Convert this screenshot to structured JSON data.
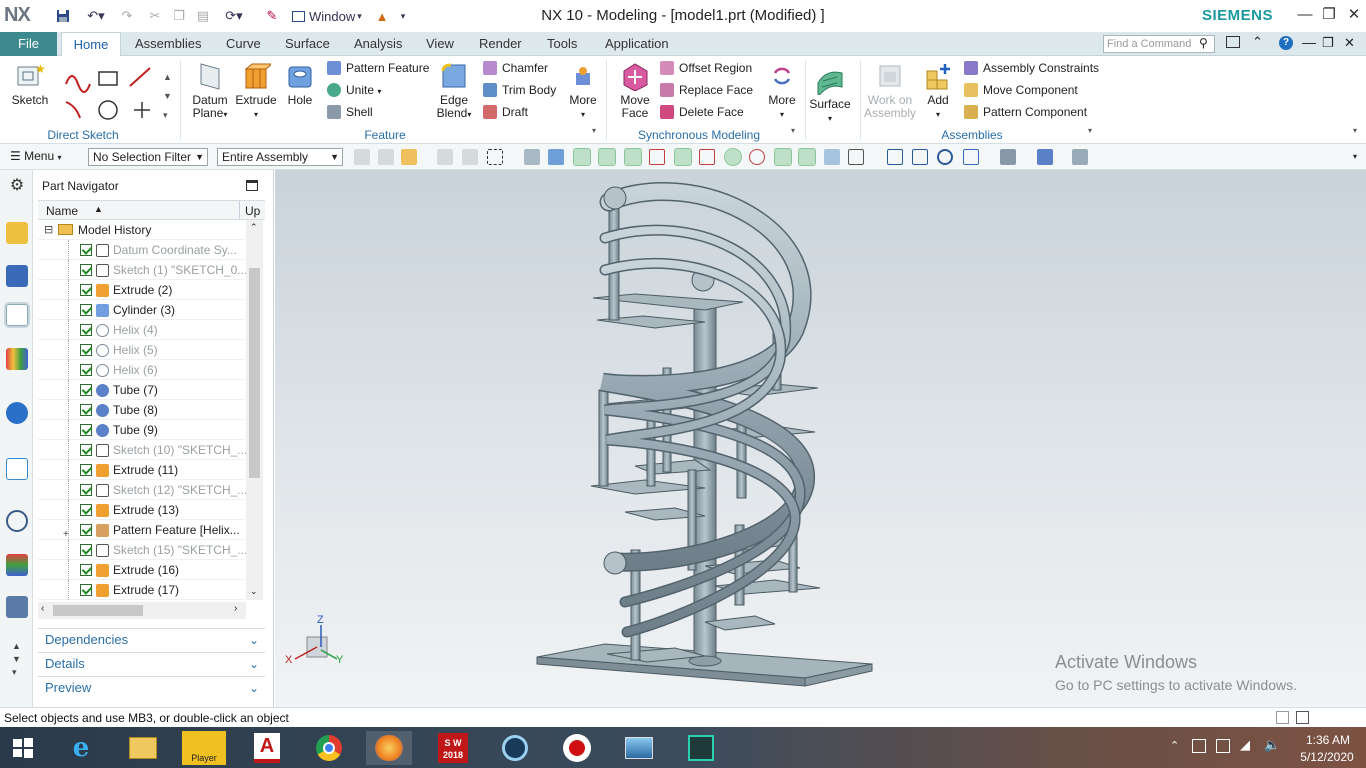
{
  "titlebar": {
    "logo": "NX",
    "window_menu": "Window",
    "title": "NX 10 - Modeling - [model1.prt (Modified) ]",
    "brand": "SIEMENS",
    "brand_color": "#1a9aa0"
  },
  "ribbon_tabs": {
    "file": "File",
    "tabs": [
      "Home",
      "Assemblies",
      "Curve",
      "Surface",
      "Analysis",
      "View",
      "Render",
      "Tools",
      "Application"
    ],
    "active": "Home",
    "find_placeholder": "Find a Command"
  },
  "ribbon": {
    "direct_sketch": {
      "sketch": "Sketch",
      "group": "Direct Sketch"
    },
    "feature": {
      "datum_plane_1": "Datum",
      "datum_plane_2": "Plane",
      "extrude": "Extrude",
      "hole": "Hole",
      "pattern_feature": "Pattern Feature",
      "unite": "Unite",
      "shell": "Shell",
      "edge_blend_1": "Edge",
      "edge_blend_2": "Blend",
      "chamfer": "Chamfer",
      "trim_body": "Trim Body",
      "draft": "Draft",
      "more": "More",
      "group": "Feature"
    },
    "sync": {
      "move_face_1": "Move",
      "move_face_2": "Face",
      "offset_region": "Offset Region",
      "replace_face": "Replace Face",
      "delete_face": "Delete Face",
      "more": "More",
      "group": "Synchronous Modeling"
    },
    "surface": {
      "label": "Surface"
    },
    "assemblies": {
      "work_on_1": "Work on",
      "work_on_2": "Assembly",
      "add": "Add",
      "constraints": "Assembly Constraints",
      "move_component": "Move Component",
      "pattern_component": "Pattern Component",
      "group": "Assemblies"
    }
  },
  "toolbar": {
    "menu": "Menu",
    "selection_filter": "No Selection Filter",
    "scope": "Entire Assembly"
  },
  "navigator": {
    "title": "Part Navigator",
    "col_name": "Name",
    "col_up": "Up",
    "rows": [
      {
        "label": "Model History"
      },
      {
        "label": "Datum Coordinate Sy..."
      },
      {
        "label": "Sketch (1) \"SKETCH_0..."
      },
      {
        "label": "Extrude (2)"
      },
      {
        "label": "Cylinder (3)"
      },
      {
        "label": "Helix (4)"
      },
      {
        "label": "Helix (5)"
      },
      {
        "label": "Helix (6)"
      },
      {
        "label": "Tube (7)"
      },
      {
        "label": "Tube (8)"
      },
      {
        "label": "Tube (9)"
      },
      {
        "label": "Sketch (10) \"SKETCH_..."
      },
      {
        "label": "Extrude (11)"
      },
      {
        "label": "Sketch (12) \"SKETCH_..."
      },
      {
        "label": "Extrude (13)"
      },
      {
        "label": "Pattern Feature [Helix..."
      },
      {
        "label": "Sketch (15) \"SKETCH_..."
      },
      {
        "label": "Extrude (16)"
      },
      {
        "label": "Extrude (17)"
      }
    ],
    "panels": [
      "Dependencies",
      "Details",
      "Preview"
    ]
  },
  "viewport": {
    "triad": {
      "z": "Z",
      "x": "X",
      "y": "Y"
    },
    "watermark_title": "Activate Windows",
    "watermark_sub": "Go to PC settings to activate Windows."
  },
  "status": "Select objects and use MB3, or double-click an object",
  "taskbar": {
    "player_label": "Player",
    "sw_label": "2018",
    "time": "1:36 AM",
    "date": "5/12/2020"
  }
}
